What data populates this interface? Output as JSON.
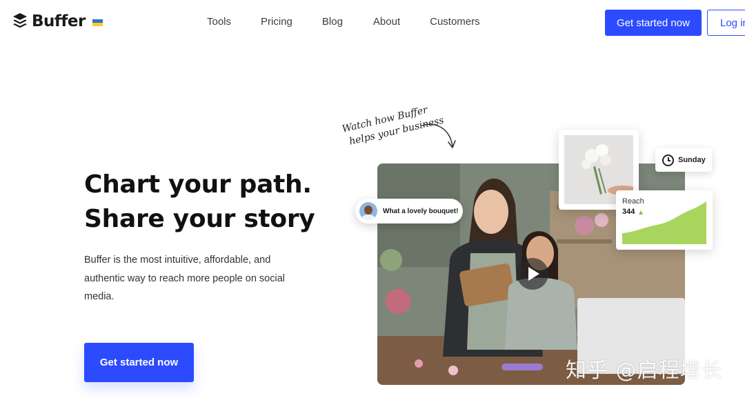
{
  "header": {
    "brand": "Buffer",
    "nav": [
      "Tools",
      "Pricing",
      "Blog",
      "About",
      "Customers"
    ],
    "cta_label": "Get started now",
    "login_label": "Log in"
  },
  "hero": {
    "title_line1": "Chart your path.",
    "title_line2": "Share your story",
    "description": "Buffer is the most intuitive, affordable, and authentic way to reach more people on social media.",
    "cta_label": "Get started now"
  },
  "media": {
    "handwritten_line1": "Watch how Buffer",
    "handwritten_line2": "helps your business",
    "comment": "What a lovely bouquet!",
    "schedule_day": "Sunday",
    "reach_label": "Reach",
    "reach_value": "344",
    "reach_trend": "up"
  },
  "icons": [
    "buffer-logo-icon",
    "ukraine-flag-icon",
    "play-icon",
    "clock-icon",
    "arrow-up-icon",
    "curved-arrow-icon",
    "avatar"
  ],
  "colors": {
    "primary": "#2c4bff",
    "chart_green": "#a8d55e",
    "text_dark": "#111111"
  },
  "watermark": "知乎 @启程增长"
}
